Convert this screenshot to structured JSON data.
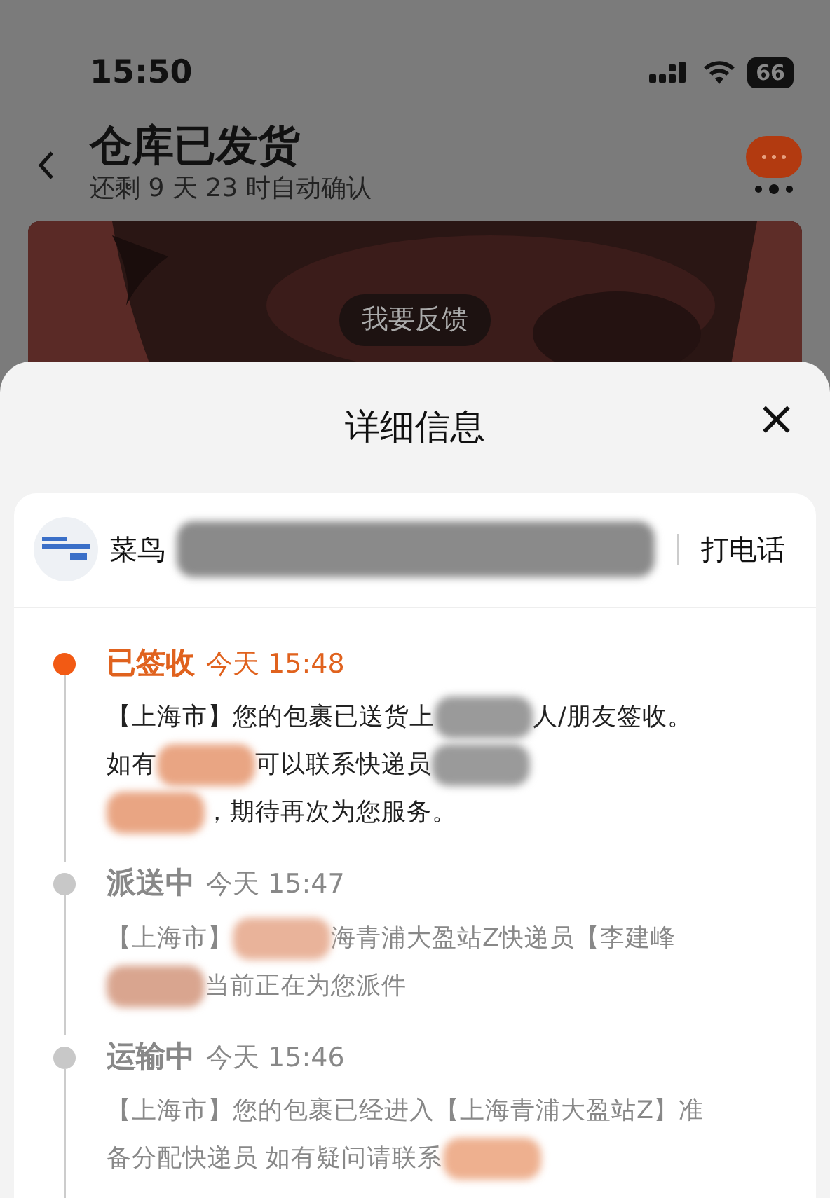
{
  "status_bar": {
    "time": "15:50",
    "battery": "66"
  },
  "header": {
    "title": "仓库已发货",
    "subtitle": "还剩 9 天 23 时自动确认"
  },
  "banner": {
    "button": "我要反馈"
  },
  "sheet": {
    "title": "详细信息",
    "close": "×",
    "courier": {
      "name": "菜鸟",
      "redaction": {
        "color": "#8a8a8a"
      },
      "call": "打电话"
    },
    "events": [
      {
        "status": "已签收",
        "time": "今天 15:48",
        "active": true,
        "lines": [
          [
            {
              "kind": "text",
              "text": "【上海市】您的包裹已送货上"
            },
            {
              "kind": "redaction",
              "color": "#9a9a9a"
            },
            {
              "kind": "text",
              "text": "人/朋友签收。"
            }
          ],
          [
            {
              "kind": "text",
              "text": "如有"
            },
            {
              "kind": "redaction",
              "color": "#e9a583"
            },
            {
              "kind": "text",
              "text": "可以联系快递员"
            },
            {
              "kind": "redaction",
              "color": "#9a9a9a"
            }
          ],
          [
            {
              "kind": "redaction",
              "color": "#e9a583"
            },
            {
              "kind": "text",
              "text": "，期待再次为您服务。"
            }
          ]
        ]
      },
      {
        "status": "派送中",
        "time": "今天 15:47",
        "active": false,
        "lines": [
          [
            {
              "kind": "text",
              "text": "【上海市】"
            },
            {
              "kind": "redaction",
              "color": "#e9b39a"
            },
            {
              "kind": "text",
              "text": "海青浦大盈站Z快递员【李建峰"
            }
          ],
          [
            {
              "kind": "redaction",
              "color": "#d9a58f"
            },
            {
              "kind": "text",
              "text": "当前正在为您派件"
            }
          ]
        ]
      },
      {
        "status": "运输中",
        "time": "今天 15:46",
        "active": false,
        "lines": [
          [
            {
              "kind": "text",
              "text": "【上海市】您的包裹已经进入【上海青浦大盈站Z】准"
            }
          ],
          [
            {
              "kind": "text",
              "text": "备分配快递员 如有疑问请联系"
            },
            {
              "kind": "redaction",
              "color": "#eeb08f"
            }
          ]
        ]
      }
    ]
  }
}
